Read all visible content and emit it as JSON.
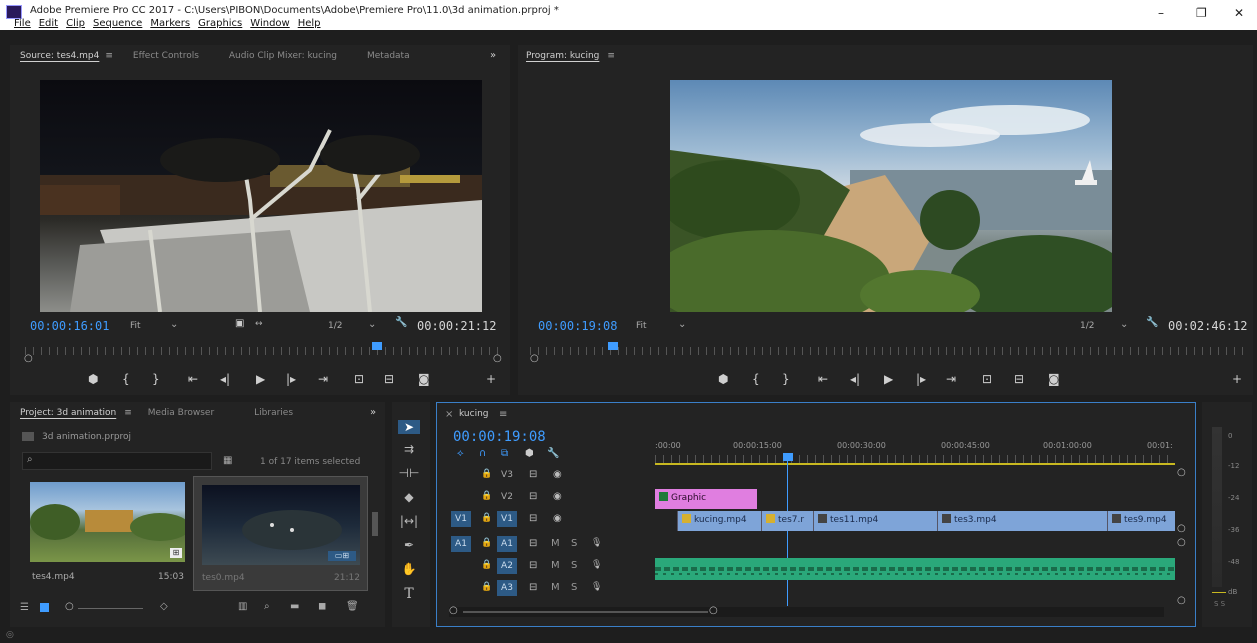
{
  "window": {
    "title": "Adobe Premiere Pro CC 2017 - C:\\Users\\PIBON\\Documents\\Adobe\\Premiere Pro\\11.0\\3d animation.prproj *",
    "menu": [
      "File",
      "Edit",
      "Clip",
      "Sequence",
      "Markers",
      "Graphics",
      "Window",
      "Help"
    ],
    "controls": {
      "minimize": "–",
      "restore": "❐",
      "close": "✕"
    }
  },
  "source_panel": {
    "tabs": [
      "Source: tes4.mp4",
      "Effect Controls",
      "Audio Clip Mixer: kucing",
      "Metadata"
    ],
    "more": "»",
    "menu_icon": "≡",
    "current_time": "00:00:16:01",
    "fit": "Fit",
    "resolution": "1/2",
    "duration": "00:00:21:12"
  },
  "program_panel": {
    "tab": "Program: kucing",
    "menu_icon": "≡",
    "current_time": "00:00:19:08",
    "fit": "Fit",
    "resolution": "1/2",
    "duration": "00:02:46:12"
  },
  "transport_icons": [
    "marker-icon",
    "mark-in-icon",
    "mark-out-icon",
    "go-to-in-icon",
    "step-back-icon",
    "play-icon",
    "step-forward-icon",
    "go-to-out-icon",
    "insert-icon",
    "overwrite-icon",
    "export-frame-icon",
    "add-button-icon"
  ],
  "project_panel": {
    "tabs": [
      "Project: 3d animation",
      "Media Browser",
      "Libraries"
    ],
    "menu_icon": "≡",
    "more": "»",
    "project_name": "3d animation.prproj",
    "items_selected": "1 of 17 items selected",
    "items": [
      {
        "name": "tes4.mp4",
        "duration": "15:03"
      },
      {
        "name": "tes0.mp4",
        "duration": "21:12"
      }
    ]
  },
  "timeline": {
    "sequence_name": "kucing",
    "menu_icon": "≡",
    "close": "×",
    "current_time": "00:00:19:08",
    "ruler_labels": [
      ":00:00",
      "00:00:15:00",
      "00:00:30:00",
      "00:00:45:00",
      "00:01:00:00",
      "00:01:"
    ],
    "tracks": [
      {
        "source": "",
        "name": "V3",
        "kind": "video"
      },
      {
        "source": "",
        "name": "V2",
        "kind": "video"
      },
      {
        "source": "V1",
        "name": "V1",
        "kind": "video"
      },
      {
        "source": "A1",
        "name": "A1",
        "kind": "audio"
      },
      {
        "source": "",
        "name": "A2",
        "kind": "audio"
      },
      {
        "source": "",
        "name": "A3",
        "kind": "audio"
      }
    ],
    "audio_btn_labels": {
      "mute": "M",
      "solo": "S"
    },
    "graphic_clip": "Graphic",
    "video_clips": [
      "kucing.mp4",
      "tes7.r",
      "tes11.mp4",
      "tes3.mp4",
      "tes9.mp4"
    ]
  },
  "meter_labels": [
    "0",
    "-12",
    "-24",
    "-36",
    "-48",
    "dB"
  ],
  "meter_footer": "S S",
  "colors": {
    "accent": "#3f9cff",
    "graphic_clip": "#e07ee0",
    "video_clip": "#7ea4d8",
    "audio_clip": "#2aa87a"
  }
}
